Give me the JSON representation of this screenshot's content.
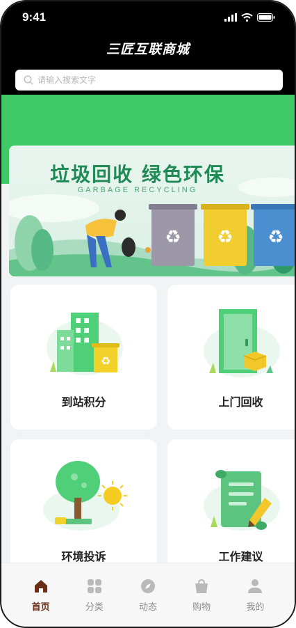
{
  "status_bar": {
    "time": "9:41"
  },
  "header": {
    "title": "三匠互联商城"
  },
  "search": {
    "placeholder": "请输入搜索文字"
  },
  "banner": {
    "title": "垃圾回收 绿色环保",
    "subtitle": "GARBAGE RECYCLING"
  },
  "cards": [
    {
      "label": "到站积分",
      "icon": "building-bin-icon"
    },
    {
      "label": "上门回收",
      "icon": "door-box-icon"
    },
    {
      "label": "环境投诉",
      "icon": "tree-sun-icon"
    },
    {
      "label": "工作建议",
      "icon": "scroll-pencil-icon"
    }
  ],
  "tabs": [
    {
      "label": "首页",
      "icon": "home-icon",
      "active": true
    },
    {
      "label": "分类",
      "icon": "grid-icon"
    },
    {
      "label": "动态",
      "icon": "compass-icon"
    },
    {
      "label": "购物",
      "icon": "shopping-bag-icon"
    },
    {
      "label": "我的",
      "icon": "user-icon"
    }
  ],
  "colors": {
    "brand_green": "#3fca67",
    "header_bg": "#000000",
    "active_tab": "#6a2e14"
  }
}
